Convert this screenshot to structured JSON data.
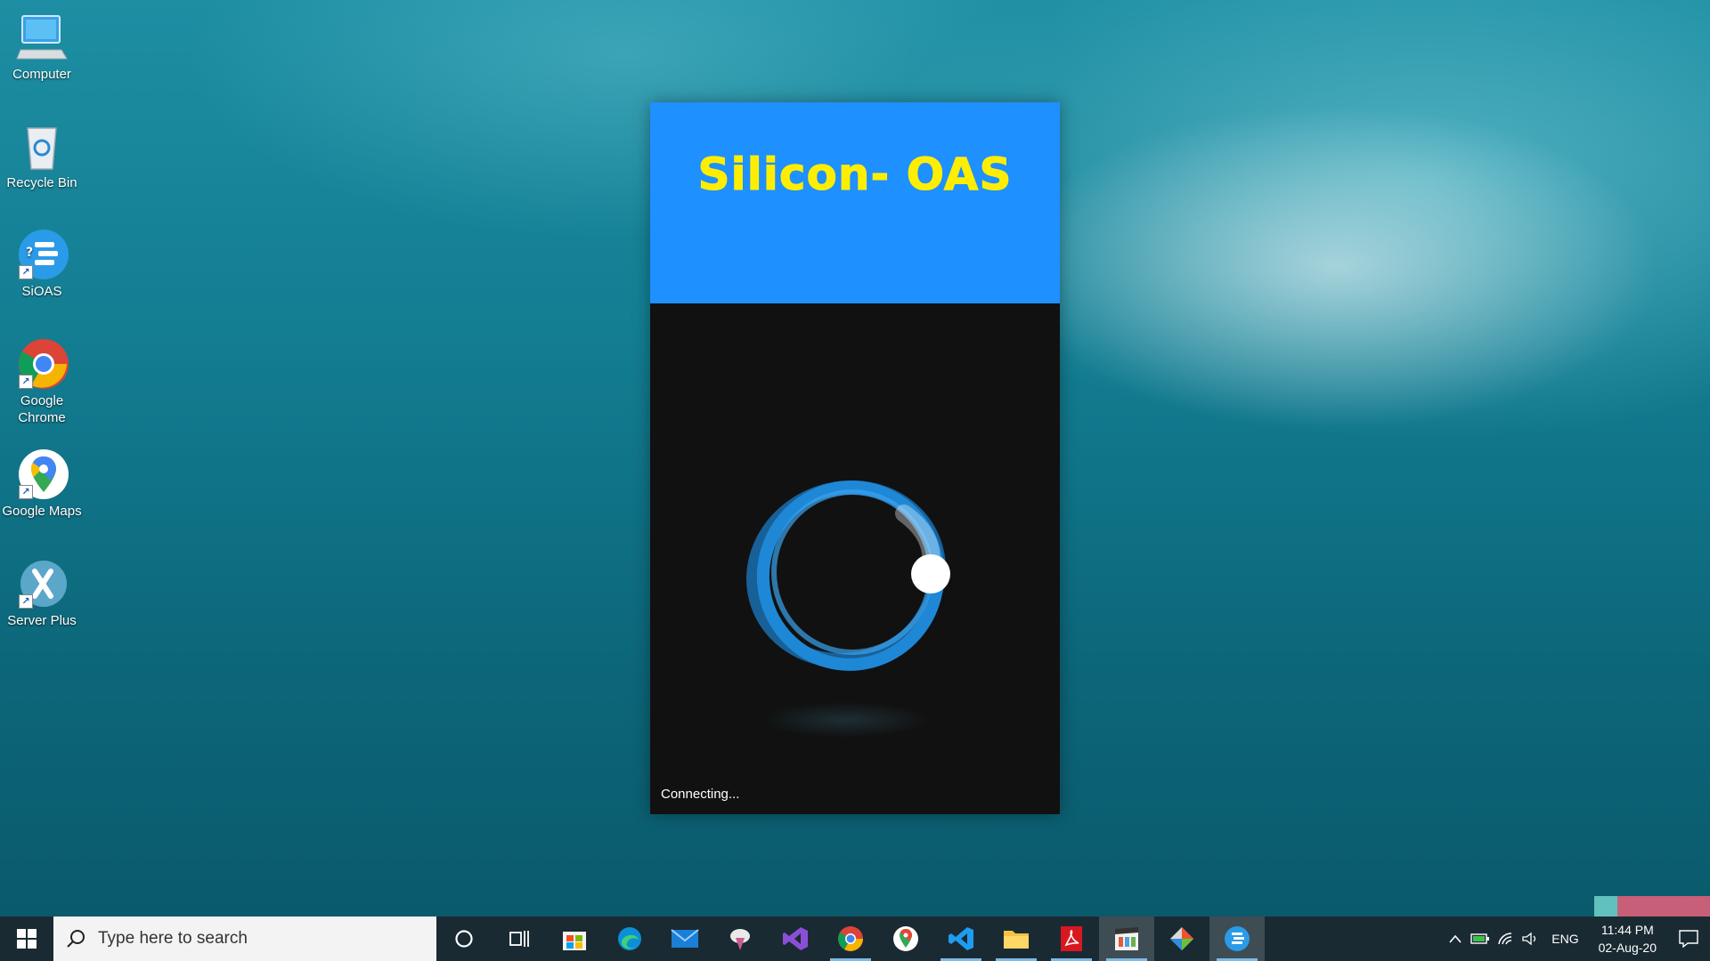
{
  "desktop": {
    "icons": [
      {
        "label": "Computer",
        "icon": "computer-icon"
      },
      {
        "label": "Recycle Bin",
        "icon": "recycle-bin-icon"
      },
      {
        "label": "SiOAS",
        "icon": "sioas-icon"
      },
      {
        "label": "Google Chrome",
        "icon": "chrome-icon"
      },
      {
        "label": "Google Maps",
        "icon": "google-maps-icon"
      },
      {
        "label": "Server Plus",
        "icon": "xampp-icon"
      }
    ]
  },
  "app": {
    "title": "Silicon- OAS",
    "status": "Connecting...",
    "colors": {
      "header": "#1e90ff",
      "title": "#ffee00",
      "body": "#111111",
      "ring": "#1e88d6"
    }
  },
  "taskbar": {
    "search_placeholder": "Type here to search",
    "pinned": [
      {
        "name": "cortana-icon"
      },
      {
        "name": "task-view-icon"
      },
      {
        "name": "microsoft-store-icon"
      },
      {
        "name": "edge-icon"
      },
      {
        "name": "mail-icon"
      },
      {
        "name": "paint-3d-icon"
      },
      {
        "name": "visual-studio-icon"
      },
      {
        "name": "chrome-icon"
      },
      {
        "name": "google-maps-icon"
      },
      {
        "name": "vscode-icon"
      },
      {
        "name": "file-explorer-icon"
      },
      {
        "name": "acrobat-icon"
      },
      {
        "name": "video-editor-icon"
      },
      {
        "name": "git-icon"
      },
      {
        "name": "sioas-icon"
      }
    ],
    "tray": {
      "language": "ENG",
      "time": "11:44 PM",
      "date": "02-Aug-20"
    }
  }
}
